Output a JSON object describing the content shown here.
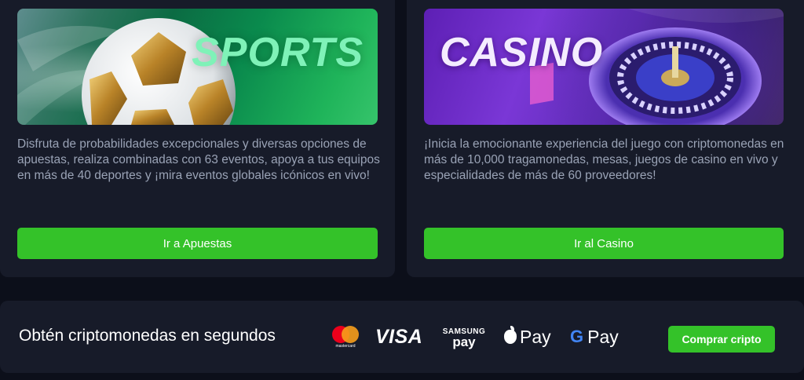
{
  "sports": {
    "banner_title": "SPORTS",
    "description": "Disfruta de probabilidades excepcionales y diversas opciones de apuestas, realiza combinadas con 63 eventos, apoya a tus equipos en más de 40 deportes y ¡mira eventos globales icónicos en vivo!",
    "button_label": "Ir a Apuestas"
  },
  "casino": {
    "banner_title": "CASINO",
    "description": "¡Inicia la emocionante experiencia del juego con criptomonedas en más de 10,000 tragamonedas, mesas, juegos de casino en vivo y especialidades de más de 60 proveedores!",
    "button_label": "Ir al Casino"
  },
  "crypto_bar": {
    "text": "Obtén criptomonedas en segundos",
    "button_label": "Comprar cripto",
    "payment_logos": {
      "mastercard": "mastercard",
      "visa": "VISA",
      "samsung_top": "SAMSUNG",
      "samsung_bottom": "pay",
      "apple_pay": "Pay",
      "google_g": "G",
      "google_pay": "Pay"
    }
  },
  "colors": {
    "accent_green": "#34c229",
    "background": "#0c0f1a",
    "card": "#171b29",
    "text_muted": "#9aa3b6"
  },
  "icons": [
    "soccer-ball-icon",
    "roulette-wheel-icon",
    "mastercard-icon",
    "apple-icon",
    "google-icon"
  ]
}
